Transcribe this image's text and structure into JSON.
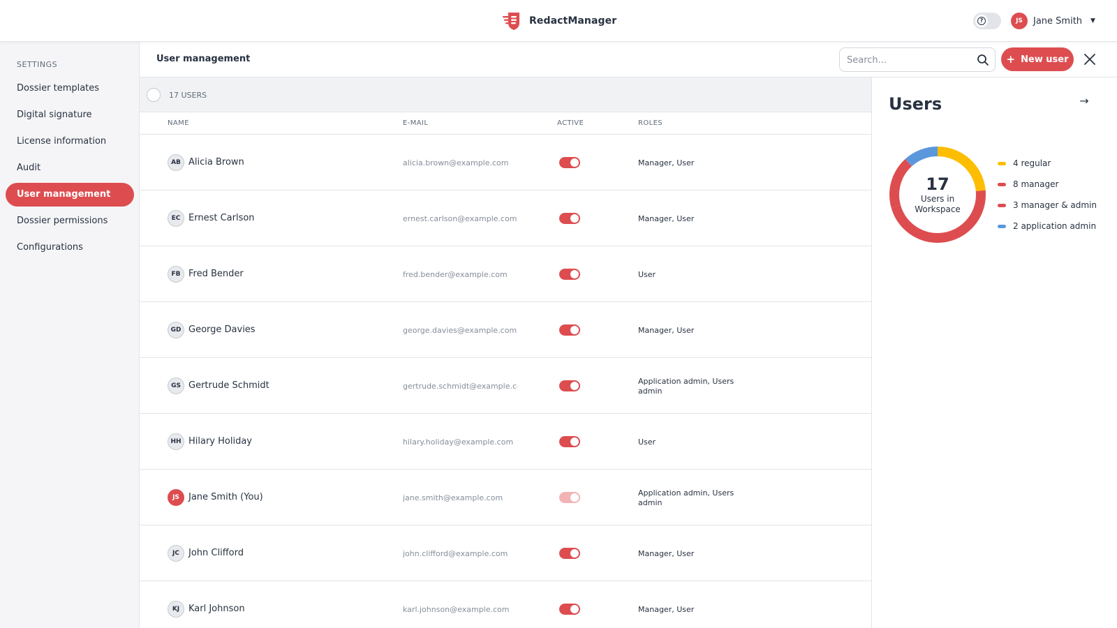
{
  "app": {
    "name": "RedactManager",
    "current_user": {
      "name": "Jane Smith",
      "initials": "JS"
    }
  },
  "sidebar": {
    "heading": "SETTINGS",
    "items": [
      {
        "label": "Dossier templates",
        "active": false
      },
      {
        "label": "Digital signature",
        "active": false
      },
      {
        "label": "License information",
        "active": false
      },
      {
        "label": "Audit",
        "active": false
      },
      {
        "label": "User management",
        "active": true
      },
      {
        "label": "Dossier permissions",
        "active": false
      },
      {
        "label": "Configurations",
        "active": false
      }
    ]
  },
  "header": {
    "title": "User management",
    "search_placeholder": "Search...",
    "new_user_label": "New user"
  },
  "list": {
    "count_label": "17 USERS",
    "columns": {
      "name": "NAME",
      "email": "E-MAIL",
      "active": "ACTIVE",
      "roles": "ROLES"
    },
    "rows": [
      {
        "initials": "AB",
        "name": "Alicia Brown",
        "email": "alicia.brown@example.com",
        "active": true,
        "self": false,
        "roles": "Manager, User"
      },
      {
        "initials": "EC",
        "name": "Ernest Carlson",
        "email": "ernest.carlson@example.com",
        "active": true,
        "self": false,
        "roles": "Manager, User"
      },
      {
        "initials": "FB",
        "name": "Fred Bender",
        "email": "fred.bender@example.com",
        "active": true,
        "self": false,
        "roles": "User"
      },
      {
        "initials": "GD",
        "name": "George Davies",
        "email": "george.davies@example.com",
        "active": true,
        "self": false,
        "roles": "Manager, User"
      },
      {
        "initials": "GS",
        "name": "Gertrude Schmidt",
        "email": "gertrude.schmidt@example.cc",
        "active": true,
        "self": false,
        "roles": "Application admin, Users admin"
      },
      {
        "initials": "HH",
        "name": "Hilary Holiday",
        "email": "hilary.holiday@example.com",
        "active": true,
        "self": false,
        "roles": "User"
      },
      {
        "initials": "JS",
        "name": "Jane Smith (You)",
        "email": "jane.smith@example.com",
        "active": true,
        "self": true,
        "roles": "Application admin, Users admin"
      },
      {
        "initials": "JC",
        "name": "John Clifford",
        "email": "john.clifford@example.com",
        "active": true,
        "self": false,
        "roles": "Manager, User"
      },
      {
        "initials": "KJ",
        "name": "Karl Johnson",
        "email": "karl.johnson@example.com",
        "active": true,
        "self": false,
        "roles": "Manager, User"
      }
    ]
  },
  "panel": {
    "title": "Users",
    "total": "17",
    "caption": "Users in Workspace",
    "legend": [
      {
        "label": "4 regular",
        "count": 4,
        "color": "#fdbd00"
      },
      {
        "label": "8 manager",
        "count": 8,
        "color": "#dd4d50"
      },
      {
        "label": "3 manager & admin",
        "count": 3,
        "color": "#dd4d50"
      },
      {
        "label": "2 application admin",
        "count": 2,
        "color": "#5b97db"
      }
    ]
  },
  "colors": {
    "accent": "#dd4d50",
    "regular": "#fdbd00",
    "application_admin": "#5b97db"
  }
}
